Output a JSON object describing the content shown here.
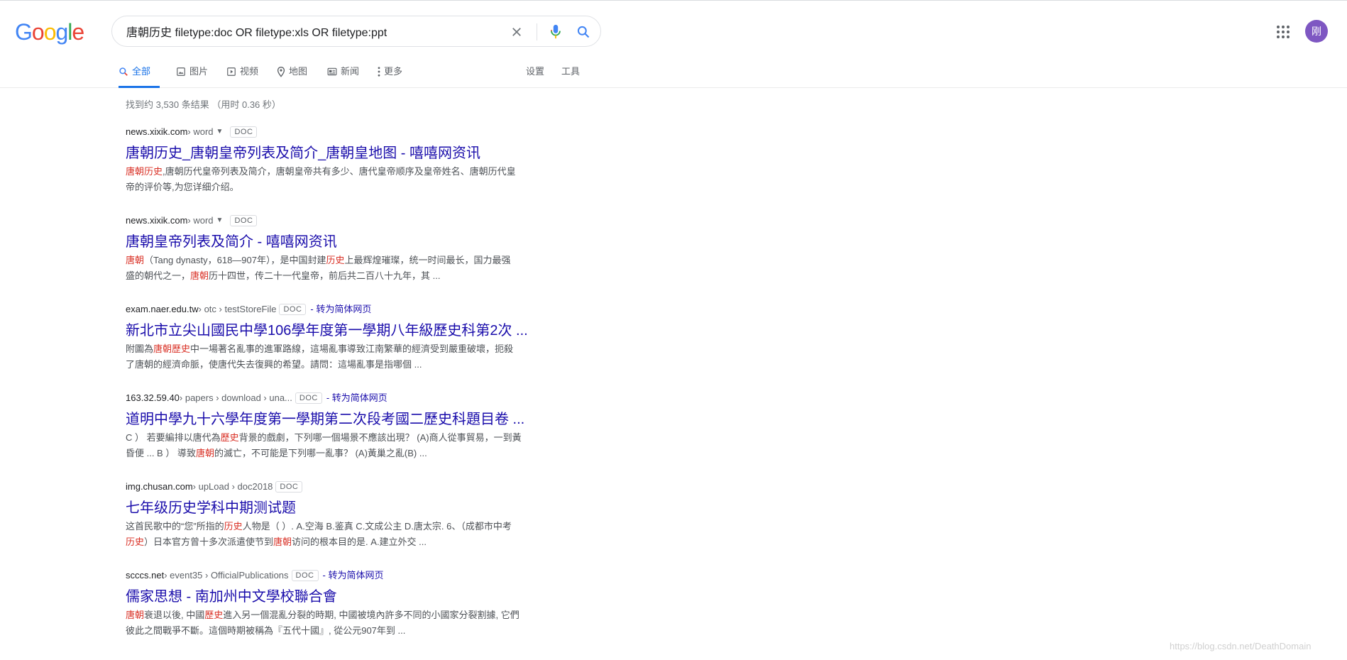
{
  "logo": {
    "letters": [
      "G",
      "o",
      "o",
      "g",
      "l",
      "e"
    ],
    "colors": [
      "#4285f4",
      "#ea4335",
      "#fbbc05",
      "#4285f4",
      "#34a853",
      "#ea4335"
    ]
  },
  "search": {
    "value": "唐朝历史 filetype:doc OR filetype:xls OR filetype:ppt"
  },
  "avatar": {
    "text": "刚"
  },
  "tabs": [
    {
      "label": "全部",
      "icon": "search-icon"
    },
    {
      "label": "图片",
      "icon": "image-icon"
    },
    {
      "label": "视频",
      "icon": "video-icon"
    },
    {
      "label": "地图",
      "icon": "map-pin-icon"
    },
    {
      "label": "新闻",
      "icon": "news-icon"
    },
    {
      "label": "更多",
      "icon": "more-vert-icon"
    },
    {
      "label": "设置"
    },
    {
      "label": "工具"
    }
  ],
  "stats": "找到约 3,530 条结果 （用时 0.36 秒）",
  "translate_label": "- 转为简体网页",
  "results": [
    {
      "domain": "news.xixik.com",
      "path": " › word",
      "badge": "DOC",
      "title": "唐朝历史_唐朝皇帝列表及简介_唐朝皇地图 - 嘻嘻网资讯",
      "snip1": [
        {
          "t": "唐朝历史",
          "h": true
        },
        {
          "t": ",唐朝历代皇帝列表及简介，唐朝皇帝共有多少、唐代皇帝顺序及皇帝姓名、唐朝历代皇"
        }
      ],
      "snip2": [
        {
          "t": "帝的评价等,为您详细介绍。"
        }
      ]
    },
    {
      "domain": "news.xixik.com",
      "path": " › word",
      "badge": "DOC",
      "title": "唐朝皇帝列表及简介 - 嘻嘻网资讯",
      "snip1": [
        {
          "t": "唐朝",
          "h": true
        },
        {
          "t": "（Tang dynasty，618—907年），是中国封建"
        },
        {
          "t": "历史",
          "h": true
        },
        {
          "t": "上最辉煌璀璨，统一时间最长，国力最强"
        }
      ],
      "snip2": [
        {
          "t": "盛的朝代之一，"
        },
        {
          "t": "唐朝",
          "h": true
        },
        {
          "t": "历十四世，传二十一代皇帝，前后共二百八十九年，其 ..."
        }
      ]
    },
    {
      "domain": "exam.naer.edu.tw",
      "path": " › otc › testStoreFile",
      "badge": "DOC",
      "title": "新北市立尖山國民中學106學年度第一學期八年級歷史科第2次 ...",
      "snip1": [
        {
          "t": "附圖為"
        },
        {
          "t": "唐朝歷史",
          "h": true
        },
        {
          "t": "中一場著名亂事的進軍路線，這場亂事導致江南繁華的經濟受到嚴重破壞，扼殺"
        }
      ],
      "snip2": [
        {
          "t": "了唐朝的經濟命脈，使唐代失去復興的希望。請問：這場亂事是指哪個 ..."
        }
      ]
    },
    {
      "domain": "163.32.59.40",
      "path": " › papers › download › una...",
      "badge": "DOC",
      "title": "道明中學九十六學年度第一學期第二次段考國二歷史科題目卷 ...",
      "snip1": [
        {
          "t": "C ） 若要編排以唐代為"
        },
        {
          "t": "歷史",
          "h": true
        },
        {
          "t": "背景的戲劇，下列哪一個場景不應該出現？ (A)商人從事貿易，一到黃"
        }
      ],
      "snip2": [
        {
          "t": "昏便 ... B ） 導致"
        },
        {
          "t": "唐朝",
          "h": true
        },
        {
          "t": "的滅亡，不可能是下列哪一亂事？ (A)黃巢之亂(B) ..."
        }
      ]
    },
    {
      "domain": "img.chusan.com",
      "path": " › upLoad › doc2018",
      "badge": "DOC",
      "title": "七年级历史学科中期测试题",
      "snip1": [
        {
          "t": "这首民歌中的“您”所指的"
        },
        {
          "t": "历史",
          "h": true
        },
        {
          "t": "人物是（ ）. A.空海 B.鉴真 C.文成公主 D.唐太宗. 6、（成都市中考"
        }
      ],
      "snip2": [
        {
          "t": "历史",
          "h": true
        },
        {
          "t": "）日本官方曾十多次派遣使节到"
        },
        {
          "t": "唐朝",
          "h": true
        },
        {
          "t": "访问的根本目的是. A.建立外交 ..."
        }
      ]
    },
    {
      "domain": "scccs.net",
      "path": " › event35 › OfficialPublications",
      "badge": "DOC",
      "title": "儒家思想 - 南加州中文學校聯合會",
      "snip1": [
        {
          "t": "唐朝",
          "h": true
        },
        {
          "t": "衰退以後, 中國"
        },
        {
          "t": "歷史",
          "h": true
        },
        {
          "t": "進入另一個混亂分裂的時期, 中國被境內許多不同的小國家分裂割據, 它們"
        }
      ],
      "snip2": [
        {
          "t": "彼此之間戰爭不斷。這個時期被稱為『五代十國』, 從公元907年到 ..."
        }
      ]
    }
  ],
  "watermark": "https://blog.csdn.net/DeathDomain"
}
